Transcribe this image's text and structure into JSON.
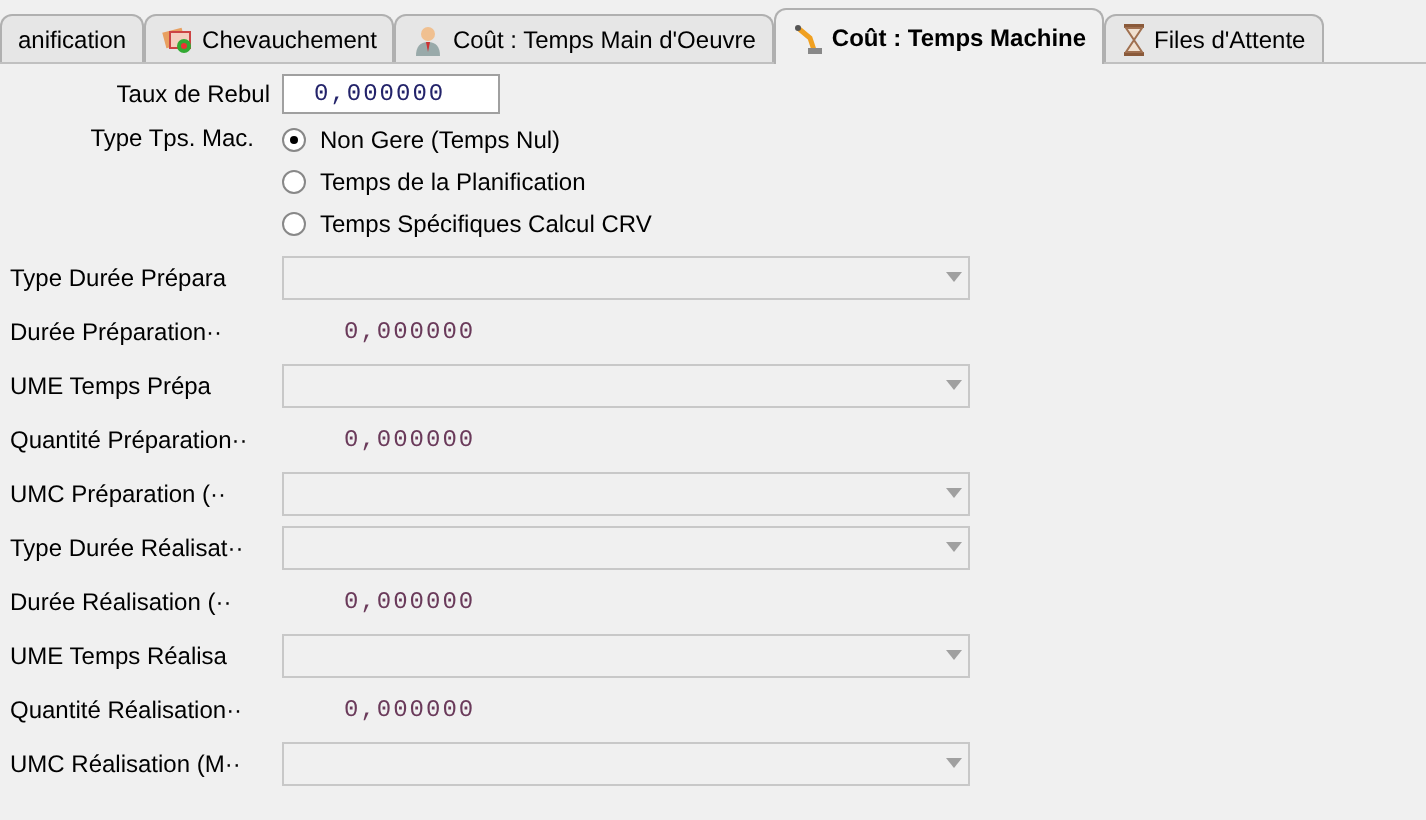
{
  "tabs": [
    {
      "label": "anification",
      "kind": "plain",
      "selected": false
    },
    {
      "label": "Chevauchement",
      "kind": "cards",
      "selected": false
    },
    {
      "label": "Coût : Temps Main d'Oeuvre",
      "kind": "person",
      "selected": false
    },
    {
      "label": "Coût : Temps Machine",
      "kind": "arm",
      "selected": true
    },
    {
      "label": "Files d'Attente",
      "kind": "hourglass",
      "selected": false
    }
  ],
  "scrap_rate": {
    "label": "Taux de Rebul",
    "value": "0,000000"
  },
  "machine_time_type": {
    "label": "Type Tps. Mac.",
    "options": [
      {
        "label": "Non Gere (Temps Nul)",
        "selected": true
      },
      {
        "label": "Temps de la Planification",
        "selected": false
      },
      {
        "label": "Temps Spécifiques Calcul CRV",
        "selected": false
      }
    ]
  },
  "fields": [
    {
      "kind": "combo",
      "label": "Type Durée Prépara"
    },
    {
      "kind": "value",
      "label": "Durée Préparation··",
      "value": "0,000000"
    },
    {
      "kind": "combo",
      "label": "UME Temps Prépa"
    },
    {
      "kind": "value",
      "label": "Quantité Préparation··",
      "value": "0,000000"
    },
    {
      "kind": "combo",
      "label": "UMC Préparation (··"
    },
    {
      "kind": "combo",
      "label": "Type Durée Réalisat··"
    },
    {
      "kind": "value",
      "label": "Durée Réalisation (··",
      "value": "0,000000"
    },
    {
      "kind": "combo",
      "label": "UME Temps Réalisa"
    },
    {
      "kind": "value",
      "label": "Quantité Réalisation··",
      "value": "0,000000"
    },
    {
      "kind": "combo",
      "label": "UMC Réalisation (M··"
    }
  ]
}
